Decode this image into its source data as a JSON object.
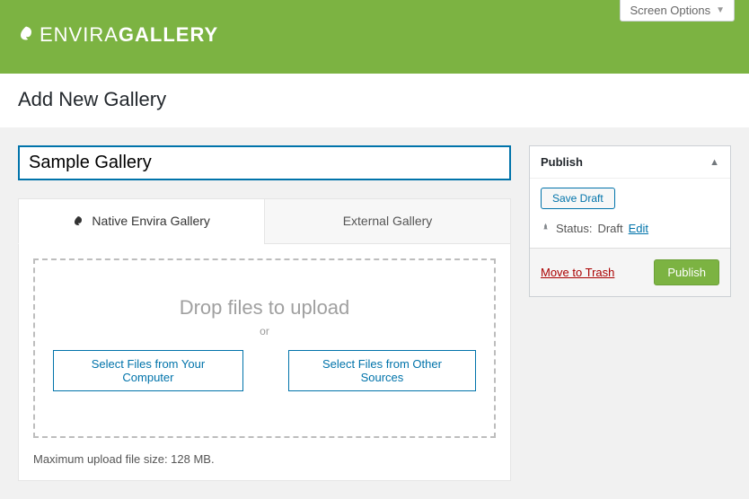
{
  "screen_options_label": "Screen Options",
  "logo": {
    "light": "ENVIRA",
    "bold": "GALLERY"
  },
  "page_title": "Add New Gallery",
  "title_input": {
    "value": "Sample Gallery"
  },
  "tabs": {
    "native": "Native Envira Gallery",
    "external": "External Gallery"
  },
  "dropzone": {
    "title": "Drop files to upload",
    "or": "or",
    "btn_computer": "Select Files from Your Computer",
    "btn_other": "Select Files from Other Sources"
  },
  "upload_note": "Maximum upload file size: 128 MB.",
  "publish_box": {
    "title": "Publish",
    "save_draft": "Save Draft",
    "status_label": "Status:",
    "status_value": "Draft",
    "edit": "Edit",
    "trash": "Move to Trash",
    "publish": "Publish"
  }
}
